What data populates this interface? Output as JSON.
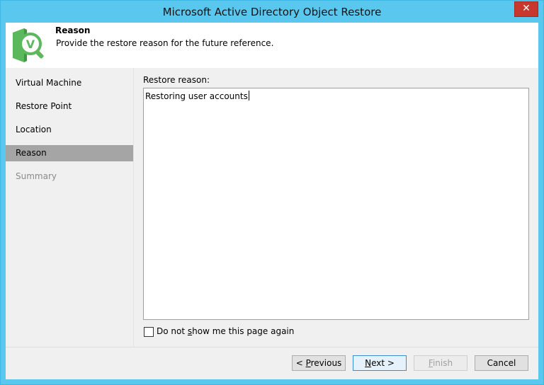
{
  "window": {
    "title": "Microsoft Active Directory Object Restore",
    "close_glyph": "✕"
  },
  "header": {
    "title": "Reason",
    "description": "Provide the restore reason for the future reference.",
    "logo_icon": "veeam-restore-wizard-icon",
    "logo_color": "#5cb85c"
  },
  "nav": {
    "items": [
      {
        "label": "Virtual Machine",
        "state": "normal"
      },
      {
        "label": "Restore Point",
        "state": "normal"
      },
      {
        "label": "Location",
        "state": "normal"
      },
      {
        "label": "Reason",
        "state": "active"
      },
      {
        "label": "Summary",
        "state": "disabled"
      }
    ]
  },
  "main": {
    "reason_label": "Restore reason:",
    "reason_value": "Restoring user accounts",
    "checkbox": {
      "label_pre": "Do not ",
      "label_accel": "s",
      "label_post": "how me this page again",
      "checked": false
    }
  },
  "buttons": {
    "previous": {
      "pre": "< ",
      "accel": "P",
      "post": "revious"
    },
    "next": {
      "pre": "",
      "accel": "N",
      "post": "ext >"
    },
    "finish": {
      "pre": "",
      "accel": "F",
      "post": "inish"
    },
    "cancel": {
      "label": "Cancel"
    }
  }
}
